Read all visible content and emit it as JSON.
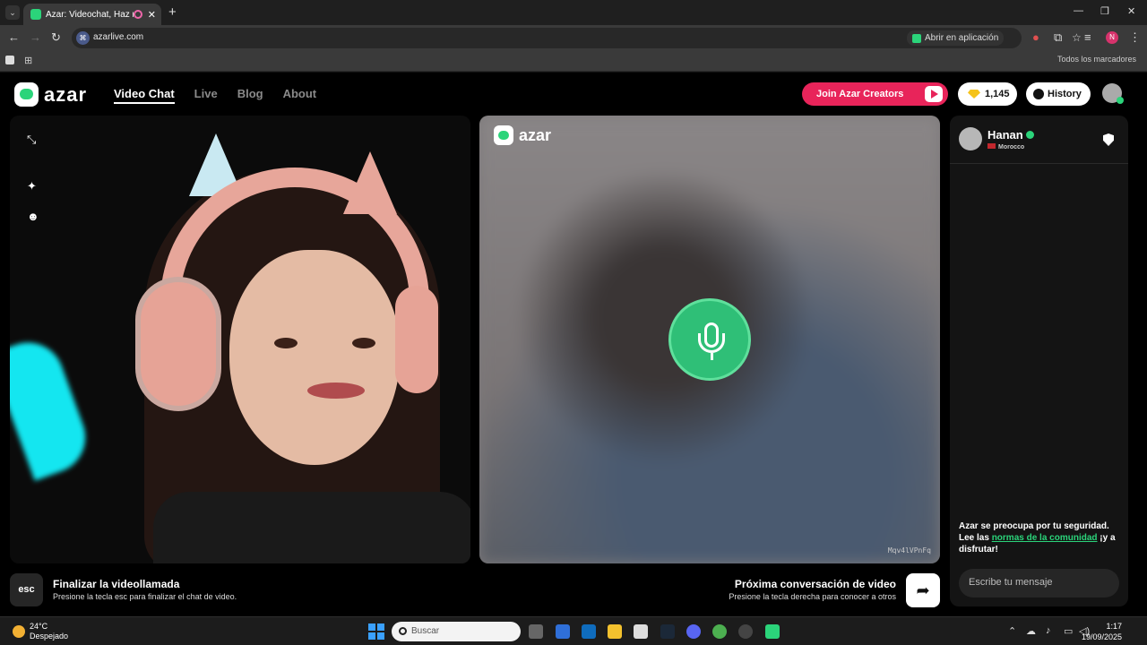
{
  "browser": {
    "tab_title": "Azar: Videochat, Haz nueva",
    "tab_close": "✕",
    "new_tab": "+",
    "url": "azarlive.com",
    "open_in_app": "Abrir en aplicación",
    "all_bookmarks": "Todos los marcadores",
    "profile_initial": "N"
  },
  "site": {
    "logo_text": "azar",
    "nav": [
      "Video Chat",
      "Live",
      "Blog",
      "About"
    ],
    "active_nav": "Video Chat",
    "creators_button": "Join Azar Creators",
    "gems_count": "1,145",
    "history_button": "History",
    "colors": {
      "accent_green": "#2bd47a",
      "creators_pink": "#e8245a",
      "gem_gold": "#f5c31a"
    }
  },
  "remote_video": {
    "logo_text": "azar",
    "user_code": "Mqv4lVPnFq",
    "center_icon": "microphone-icon"
  },
  "chat": {
    "partner_name": "Hanan",
    "partner_country": "Morocco",
    "safety_prefix": "Azar se preocupa por tu seguridad. Lee las ",
    "safety_link": "normas de la comunidad",
    "safety_suffix": " ¡y a disfrutar!",
    "message_placeholder": "Escribe tu mensaje"
  },
  "controls": {
    "esc_key": "esc",
    "end_title": "Finalizar la videollamada",
    "end_sub": "Presione la tecla esc para finalizar el chat de video.",
    "next_title": "Próxima conversación de video",
    "next_sub": "Presione la tecla derecha para conocer a otros"
  },
  "taskbar": {
    "temperature": "24°C",
    "weather": "Despejado",
    "search_placeholder": "Buscar",
    "time": "1:17",
    "date": "19/09/2025"
  }
}
